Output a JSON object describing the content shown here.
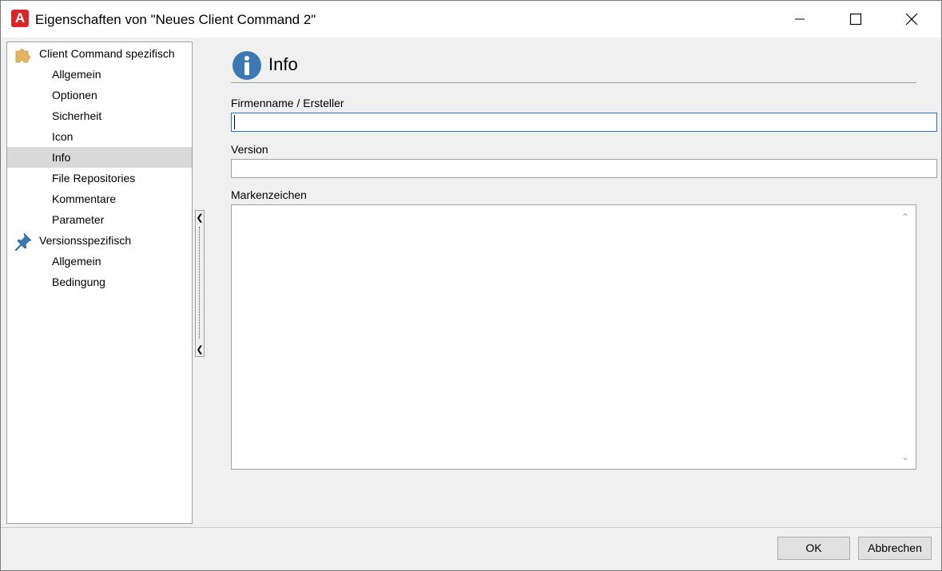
{
  "window": {
    "title": "Eigenschaften von \"Neues Client Command 2\"",
    "app_icon_letter": "A",
    "controls": [
      "minimize-icon",
      "maximize-icon",
      "close-icon"
    ]
  },
  "tree": {
    "items": [
      {
        "label": "Client Command spezifisch",
        "level": 0,
        "icon": "puzzle-icon"
      },
      {
        "label": "Allgemein",
        "level": 1
      },
      {
        "label": "Optionen",
        "level": 1
      },
      {
        "label": "Sicherheit",
        "level": 1
      },
      {
        "label": "Icon",
        "level": 1
      },
      {
        "label": "Info",
        "level": 1,
        "selected": true
      },
      {
        "label": "File Repositories",
        "level": 1
      },
      {
        "label": "Kommentare",
        "level": 1
      },
      {
        "label": "Parameter",
        "level": 1
      },
      {
        "label": "Versionsspezifisch",
        "level": 0,
        "icon": "pin-icon"
      },
      {
        "label": "Allgemein",
        "level": 1
      },
      {
        "label": "Bedingung",
        "level": 1
      }
    ]
  },
  "content": {
    "header_title": "Info",
    "header_icon": "info-icon",
    "fields": {
      "company_label": "Firmenname / Ersteller",
      "company_value": "",
      "version_label": "Version",
      "version_value": "",
      "trademark_label": "Markenzeichen",
      "trademark_value": ""
    }
  },
  "buttons": {
    "ok": "OK",
    "cancel": "Abbrechen"
  },
  "colors": {
    "app_icon": "#d8262b",
    "info_icon": "#3c78b4",
    "focus_border": "#2c6fc0",
    "selected_row": "#d9d9d9"
  }
}
